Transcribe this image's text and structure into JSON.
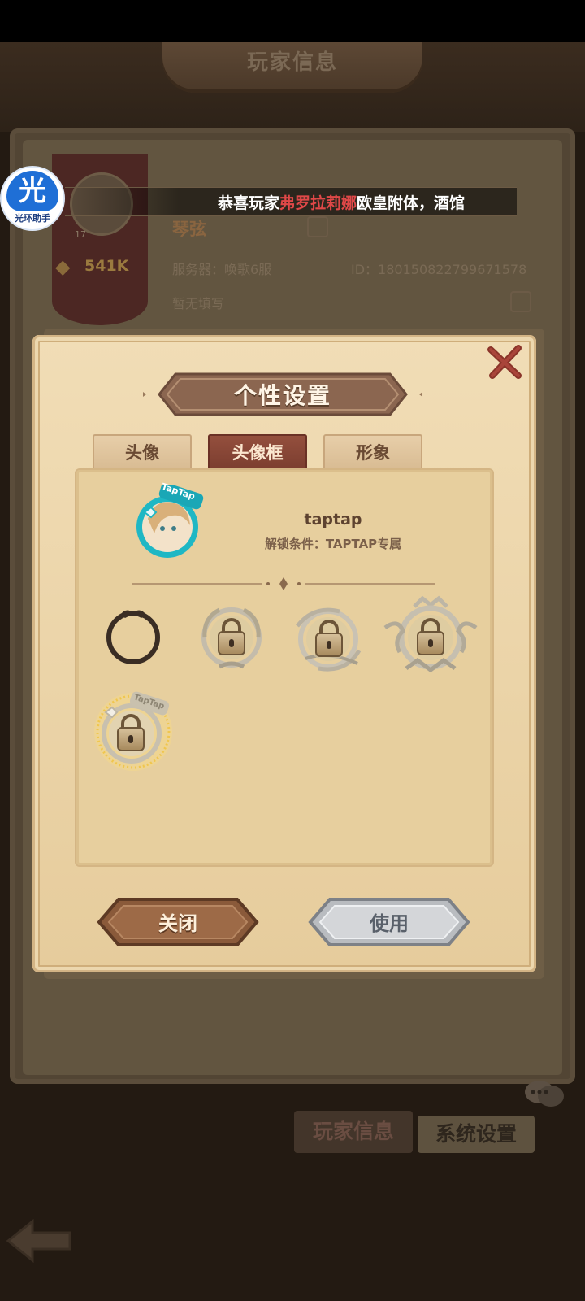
{
  "background_page": {
    "title": "玩家信息",
    "player": {
      "name": "琴弦",
      "level": "17",
      "power": "541K",
      "server": "服务器：唤歌6服",
      "id": "ID：18015082279967157​8",
      "signature": "暂无填写"
    },
    "bottom_tabs": [
      "玩家信息",
      "系统设置"
    ]
  },
  "helper": {
    "icon_char": "光",
    "label": "光环助手"
  },
  "marquee": {
    "prefix": "恭喜玩家",
    "highlight": "弗罗拉莉娜",
    "suffix": "欧皇附体，酒馆"
  },
  "dialog": {
    "title": "个性设置",
    "tabs": [
      {
        "label": "头像",
        "selected": false
      },
      {
        "label": "头像框",
        "selected": true
      },
      {
        "label": "形象",
        "selected": false
      }
    ],
    "featured": {
      "name": "taptap",
      "unlock_condition": "解锁条件：TAPTAP专属",
      "badge_text": "TapTap"
    },
    "frames": [
      {
        "icon": "dark-ring-frame-icon",
        "locked": false
      },
      {
        "icon": "laurel-frame-icon",
        "locked": true
      },
      {
        "icon": "swirl-frame-icon",
        "locked": true
      },
      {
        "icon": "ornate-frame-icon",
        "locked": true
      },
      {
        "icon": "taptap-frame-icon",
        "locked": true,
        "badge_text": "TapTap"
      }
    ],
    "buttons": {
      "close": "关闭",
      "use": "使用"
    }
  },
  "colors": {
    "accent_red": "#7b3d2f",
    "parchment": "#e7cf9e",
    "highlight_name": "#e04848",
    "taptap_teal": "#1fb7c4"
  }
}
